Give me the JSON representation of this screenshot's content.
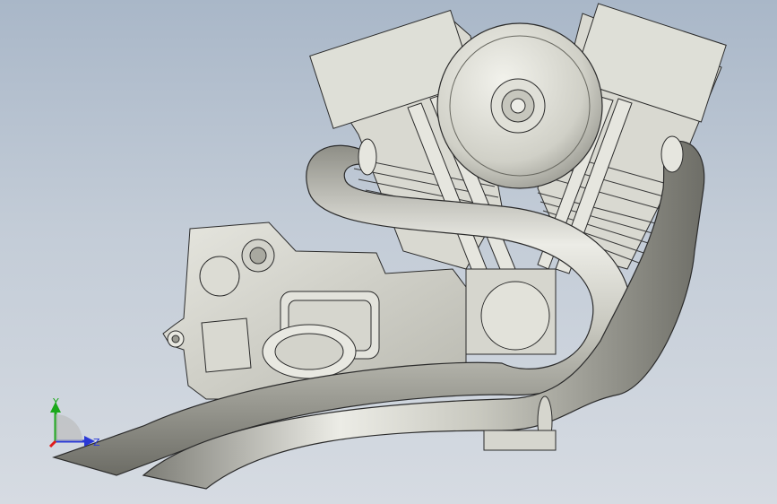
{
  "viewport": {
    "background_top": "#a9b7c8",
    "background_bottom": "#d6dbe2",
    "model_color": "#cfcfc6",
    "edge_color": "#2b2b2b"
  },
  "triad": {
    "y_label": "Y",
    "z_label": "Z",
    "y_color": "#1aa81a",
    "z_color": "#2a39d6",
    "x_color": "#e01b1b"
  }
}
